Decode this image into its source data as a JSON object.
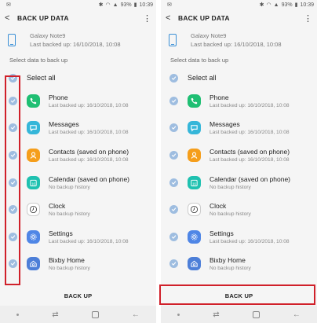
{
  "status": {
    "percent": "93%",
    "time": "10:39"
  },
  "appbar": {
    "title": "BACK UP DATA"
  },
  "device": {
    "name": "Galaxy Note9",
    "last_backup": "Last backed up: 16/10/2018, 10:08"
  },
  "section_label": "Select data to back up",
  "select_all": "Select all",
  "items": [
    {
      "name": "Phone",
      "sub": "Last backed up: 16/10/2018, 10:08",
      "color": "#1fbf73",
      "icon": "phone-icon"
    },
    {
      "name": "Messages",
      "sub": "Last backed up: 16/10/2018, 10:08",
      "color": "#35b6d9",
      "icon": "message-icon"
    },
    {
      "name": "Contacts (saved on phone)",
      "sub": "Last backed up: 16/10/2018, 10:08",
      "color": "#f59e1b",
      "icon": "contact-icon"
    },
    {
      "name": "Calendar (saved on phone)",
      "sub": "No backup history",
      "color": "#1fc1b0",
      "icon": "calendar-icon",
      "badge": "16"
    },
    {
      "name": "Clock",
      "sub": "No backup history",
      "color": "#ffffff",
      "icon": "clock-icon"
    },
    {
      "name": "Settings",
      "sub": "Last backed up: 16/10/2018, 10:08",
      "color": "#4f86e6",
      "icon": "gear-icon"
    },
    {
      "name": "Bixby Home",
      "sub": "No backup history",
      "color": "#4d7fd8",
      "icon": "bixby-home-icon"
    }
  ],
  "backup_label": "BACK UP",
  "highlight_color": "#d0202a"
}
